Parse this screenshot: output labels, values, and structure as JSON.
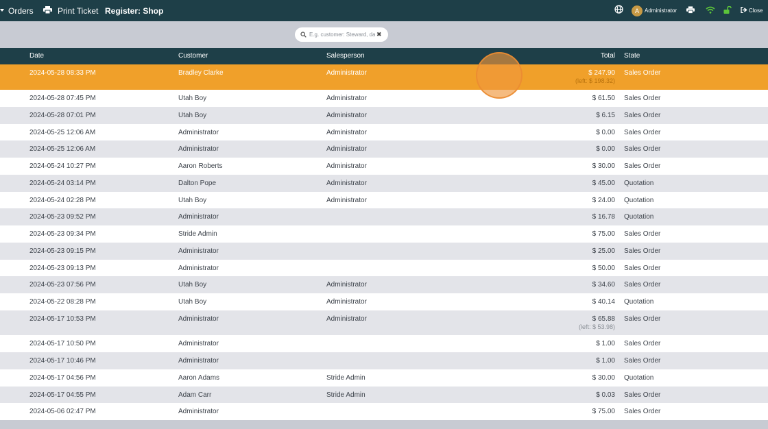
{
  "navbar": {
    "orders_label": "Orders",
    "print_ticket_label": "Print Ticket",
    "register_label": "Register: Shop",
    "user_initial": "A",
    "user_name": "Administrator",
    "close_label": "Close"
  },
  "search": {
    "placeholder": "E.g. customer: Steward, da"
  },
  "table": {
    "headers": {
      "date": "Date",
      "customer": "Customer",
      "salesperson": "Salesperson",
      "total": "Total",
      "state": "State"
    },
    "rows": [
      {
        "date": "2024-05-28 08:33 PM",
        "customer": "Bradley Clarke",
        "salesperson": "Administrator",
        "total": "$ 247.90",
        "left": "(left: $ 198.32)",
        "state": "Sales Order"
      },
      {
        "date": "2024-05-28 07:45 PM",
        "customer": "Utah Boy",
        "salesperson": "Administrator",
        "total": "$ 61.50",
        "left": "",
        "state": "Sales Order"
      },
      {
        "date": "2024-05-28 07:01 PM",
        "customer": "Utah Boy",
        "salesperson": "Administrator",
        "total": "$ 6.15",
        "left": "",
        "state": "Sales Order"
      },
      {
        "date": "2024-05-25 12:06 AM",
        "customer": "Administrator",
        "salesperson": "Administrator",
        "total": "$ 0.00",
        "left": "",
        "state": "Sales Order"
      },
      {
        "date": "2024-05-25 12:06 AM",
        "customer": "Administrator",
        "salesperson": "Administrator",
        "total": "$ 0.00",
        "left": "",
        "state": "Sales Order"
      },
      {
        "date": "2024-05-24 10:27 PM",
        "customer": "Aaron Roberts",
        "salesperson": "Administrator",
        "total": "$ 30.00",
        "left": "",
        "state": "Sales Order"
      },
      {
        "date": "2024-05-24 03:14 PM",
        "customer": "Dalton Pope",
        "salesperson": "Administrator",
        "total": "$ 45.00",
        "left": "",
        "state": "Quotation"
      },
      {
        "date": "2024-05-24 02:28 PM",
        "customer": "Utah Boy",
        "salesperson": "Administrator",
        "total": "$ 24.00",
        "left": "",
        "state": "Quotation"
      },
      {
        "date": "2024-05-23 09:52 PM",
        "customer": "Administrator",
        "salesperson": "",
        "total": "$ 16.78",
        "left": "",
        "state": "Quotation"
      },
      {
        "date": "2024-05-23 09:34 PM",
        "customer": "Stride Admin",
        "salesperson": "",
        "total": "$ 75.00",
        "left": "",
        "state": "Sales Order"
      },
      {
        "date": "2024-05-23 09:15 PM",
        "customer": "Administrator",
        "salesperson": "",
        "total": "$ 25.00",
        "left": "",
        "state": "Sales Order"
      },
      {
        "date": "2024-05-23 09:13 PM",
        "customer": "Administrator",
        "salesperson": "",
        "total": "$ 50.00",
        "left": "",
        "state": "Sales Order"
      },
      {
        "date": "2024-05-23 07:56 PM",
        "customer": "Utah Boy",
        "salesperson": "Administrator",
        "total": "$ 34.60",
        "left": "",
        "state": "Sales Order"
      },
      {
        "date": "2024-05-22 08:28 PM",
        "customer": "Utah Boy",
        "salesperson": "Administrator",
        "total": "$ 40.14",
        "left": "",
        "state": "Quotation"
      },
      {
        "date": "2024-05-17 10:53 PM",
        "customer": "Administrator",
        "salesperson": "Administrator",
        "total": "$ 65.88",
        "left": "(left: $ 53.98)",
        "state": "Sales Order"
      },
      {
        "date": "2024-05-17 10:50 PM",
        "customer": "Administrator",
        "salesperson": "",
        "total": "$ 1.00",
        "left": "",
        "state": "Sales Order"
      },
      {
        "date": "2024-05-17 10:46 PM",
        "customer": "Administrator",
        "salesperson": "",
        "total": "$ 1.00",
        "left": "",
        "state": "Sales Order"
      },
      {
        "date": "2024-05-17 04:56 PM",
        "customer": "Aaron Adams",
        "salesperson": "Stride Admin",
        "total": "$ 30.00",
        "left": "",
        "state": "Quotation"
      },
      {
        "date": "2024-05-17 04:55 PM",
        "customer": "Adam Carr",
        "salesperson": "Stride Admin",
        "total": "$ 0.03",
        "left": "",
        "state": "Sales Order"
      },
      {
        "date": "2024-05-06 02:47 PM",
        "customer": "Administrator",
        "salesperson": "",
        "total": "$ 75.00",
        "left": "",
        "state": "Sales Order"
      }
    ]
  },
  "colors": {
    "navbar": "#1e3f48",
    "selected_row": "#f0a02a",
    "row_alt": "#e3e4e9",
    "background": "#c8cbd3",
    "wifi": "#5cc43a",
    "lock": "#5cc43a"
  },
  "icons": [
    "caret-down-icon",
    "printer-icon",
    "globe-icon",
    "wifi-icon",
    "unlock-icon",
    "sign-out-icon",
    "search-icon",
    "clear-icon"
  ]
}
